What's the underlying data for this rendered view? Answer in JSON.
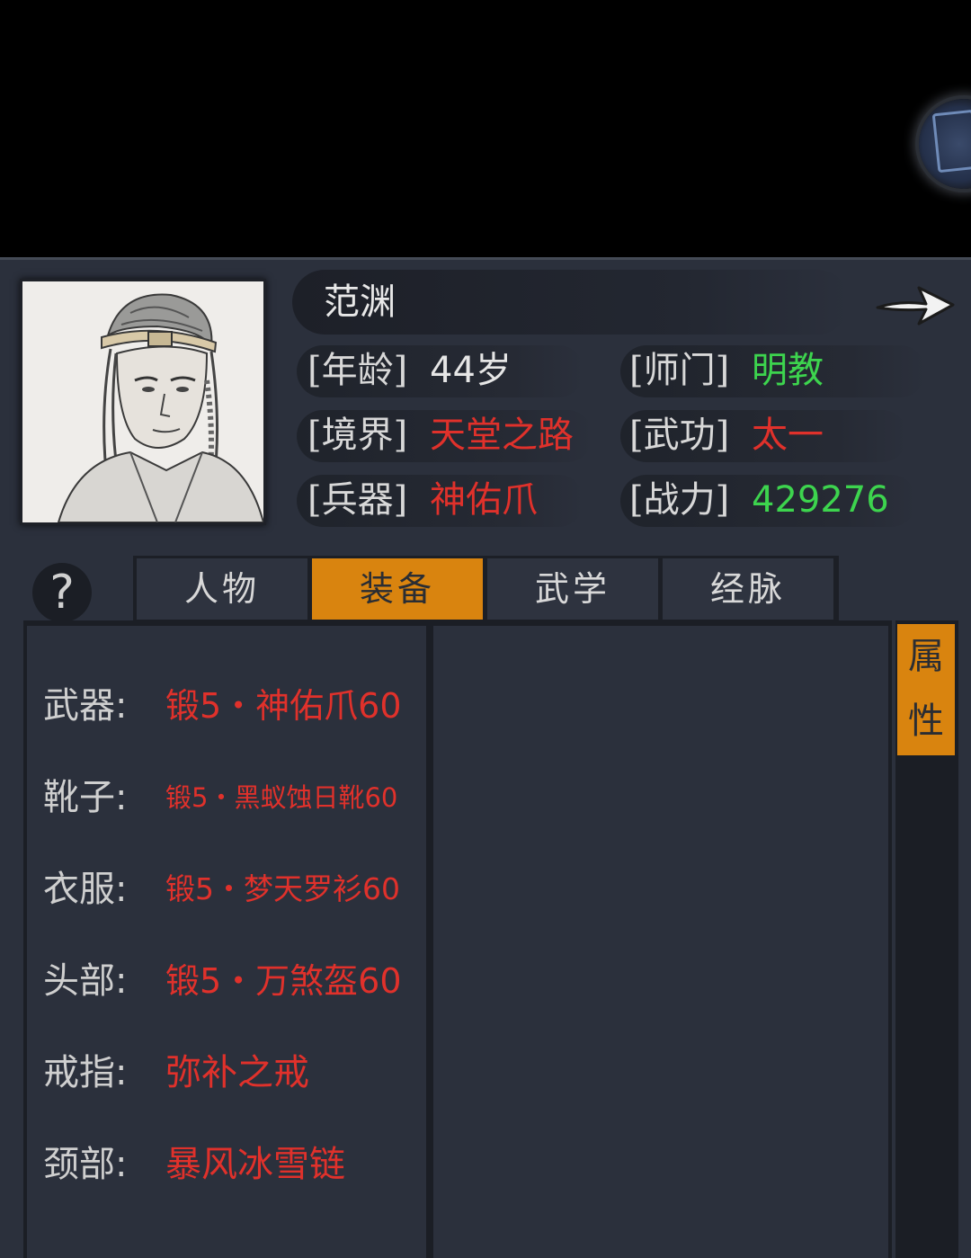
{
  "hero": {
    "name": "范渊",
    "stats": {
      "age_label": "[年龄]",
      "age": "44岁",
      "sect_label": "[师门]",
      "sect": "明教",
      "realm_label": "[境界]",
      "realm": "天堂之路",
      "martial_label": "[武功]",
      "martial": "太一",
      "weapon_label": "[兵器]",
      "weapon": "神佑爪",
      "power_label": "[战力]",
      "power": "429276"
    }
  },
  "help_label": "?",
  "tabs": [
    {
      "label": "人物",
      "active": false
    },
    {
      "label": "装备",
      "active": true
    },
    {
      "label": "武学",
      "active": false
    },
    {
      "label": "经脉",
      "active": false
    }
  ],
  "equipment": [
    {
      "slot": "武器:",
      "item": "锻5・神佑爪60"
    },
    {
      "slot": "靴子:",
      "item": "锻5・黑蚁蚀日靴60"
    },
    {
      "slot": "衣服:",
      "item": "锻5・梦天罗衫60"
    },
    {
      "slot": "头部:",
      "item": "锻5・万煞盔60"
    },
    {
      "slot": "戒指:",
      "item": "弥补之戒"
    },
    {
      "slot": "颈部:",
      "item": "暴风冰雪链"
    }
  ],
  "side_tab": {
    "line1": "属",
    "line2": "性"
  },
  "colors": {
    "accent": "#d9840f",
    "red": "#e0312b",
    "green": "#3dd44e",
    "panel": "#2b303c"
  },
  "icons": {
    "next": "arrow-right-icon",
    "help": "question-icon",
    "corner": "book-emblem-icon"
  }
}
